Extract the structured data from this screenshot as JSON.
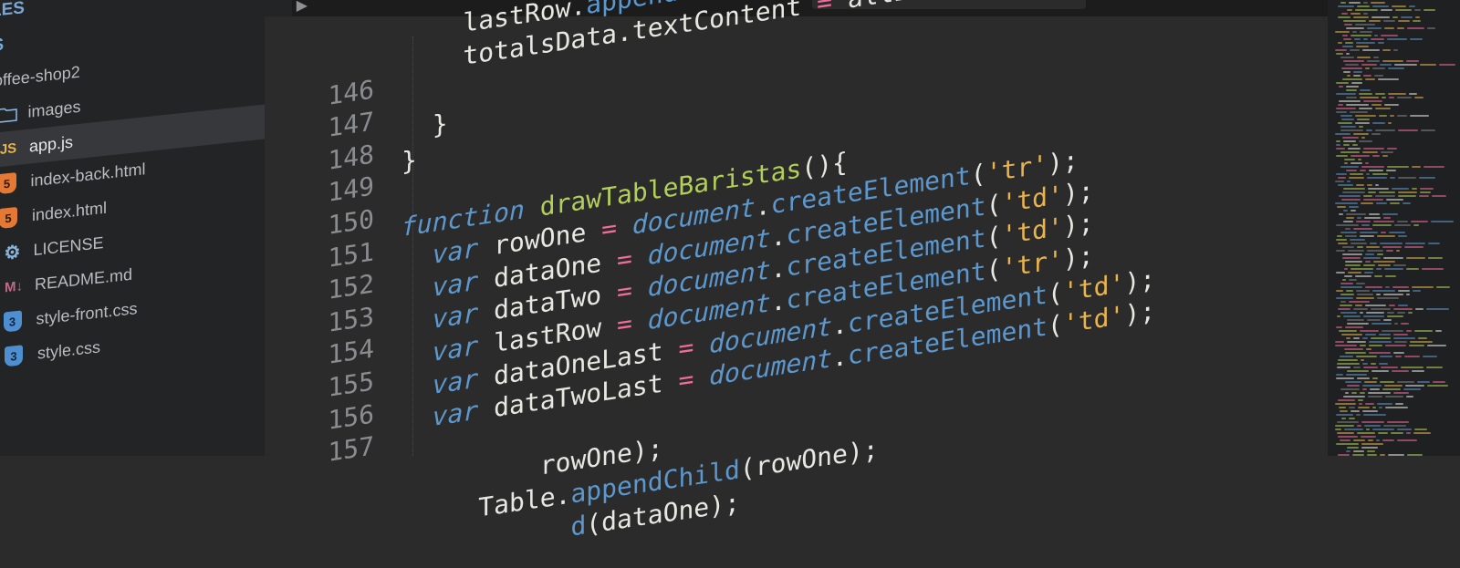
{
  "sidebar": {
    "items": [
      {
        "label": "LES",
        "kind": "header",
        "icon": "",
        "depth": 0
      },
      {
        "label": "S",
        "kind": "header",
        "icon": "",
        "depth": 0
      },
      {
        "label": "offee-shop2",
        "kind": "folder-open",
        "icon": "",
        "depth": 0
      },
      {
        "label": "images",
        "kind": "folder",
        "icon": "folder-icon",
        "depth": 1
      },
      {
        "label": "app.js",
        "kind": "file",
        "icon": "js-file-icon",
        "icon_text": "JS",
        "active": true,
        "depth": 1
      },
      {
        "label": "index-back.html",
        "kind": "file",
        "icon": "html5-file-icon",
        "icon_text": "5",
        "depth": 1
      },
      {
        "label": "index.html",
        "kind": "file",
        "icon": "html5-file-icon",
        "icon_text": "5",
        "depth": 1
      },
      {
        "label": "LICENSE",
        "kind": "file",
        "icon": "gear-icon",
        "icon_text": "⚙",
        "depth": 1
      },
      {
        "label": "README.md",
        "kind": "file",
        "icon": "markdown-icon",
        "icon_text": "M↓",
        "depth": 1
      },
      {
        "label": "style-front.css",
        "kind": "file",
        "icon": "css3-file-icon",
        "icon_text": "3",
        "depth": 1
      },
      {
        "label": "style.css",
        "kind": "file",
        "icon": "css3-file-icon",
        "icon_text": "3",
        "depth": 1
      }
    ]
  },
  "tabbar": {
    "nav_arrows": "◀ ▶"
  },
  "editor": {
    "line_numbers": [
      "",
      "146",
      "147",
      "148",
      "149",
      "150",
      "151",
      "152",
      "153",
      "154",
      "155",
      "156",
      "157"
    ],
    "lines": [
      {
        "tokens": [
          [
            "pl",
            "    lastRow."
          ],
          [
            "mt",
            "appendChild"
          ],
          [
            "pl",
            "(t"
          ]
        ]
      },
      {
        "tokens": [
          [
            "pl",
            "    totalsData.textContent "
          ],
          [
            "op",
            "="
          ],
          [
            "pl",
            " allBea"
          ]
        ]
      },
      {
        "tokens": [
          [
            "pl",
            ""
          ]
        ]
      },
      {
        "tokens": [
          [
            "pl",
            "  }"
          ]
        ]
      },
      {
        "tokens": [
          [
            "pl",
            "}"
          ]
        ]
      },
      {
        "tokens": [
          [
            "pl",
            ""
          ]
        ]
      },
      {
        "tokens": [
          [
            "kw",
            "function"
          ],
          [
            "pl",
            " "
          ],
          [
            "fn",
            "drawTableBaristas"
          ],
          [
            "pl",
            "(){"
          ]
        ]
      },
      {
        "tokens": [
          [
            "pl",
            "  "
          ],
          [
            "kw",
            "var"
          ],
          [
            "pl",
            " rowOne "
          ],
          [
            "op",
            "="
          ],
          [
            "pl",
            " "
          ],
          [
            "kw",
            "document"
          ],
          [
            "pl",
            "."
          ],
          [
            "mt",
            "createElement"
          ],
          [
            "pl",
            "("
          ],
          [
            "st",
            "'tr'"
          ],
          [
            "pl",
            ");"
          ]
        ]
      },
      {
        "tokens": [
          [
            "pl",
            "  "
          ],
          [
            "kw",
            "var"
          ],
          [
            "pl",
            " dataOne "
          ],
          [
            "op",
            "="
          ],
          [
            "pl",
            " "
          ],
          [
            "kw",
            "document"
          ],
          [
            "pl",
            "."
          ],
          [
            "mt",
            "createElement"
          ],
          [
            "pl",
            "("
          ],
          [
            "st",
            "'td'"
          ],
          [
            "pl",
            ");"
          ]
        ]
      },
      {
        "tokens": [
          [
            "pl",
            "  "
          ],
          [
            "kw",
            "var"
          ],
          [
            "pl",
            " dataTwo "
          ],
          [
            "op",
            "="
          ],
          [
            "pl",
            " "
          ],
          [
            "kw",
            "document"
          ],
          [
            "pl",
            "."
          ],
          [
            "mt",
            "createElement"
          ],
          [
            "pl",
            "("
          ],
          [
            "st",
            "'td'"
          ],
          [
            "pl",
            ");"
          ]
        ]
      },
      {
        "tokens": [
          [
            "pl",
            "  "
          ],
          [
            "kw",
            "var"
          ],
          [
            "pl",
            " lastRow "
          ],
          [
            "op",
            "="
          ],
          [
            "pl",
            " "
          ],
          [
            "kw",
            "document"
          ],
          [
            "pl",
            "."
          ],
          [
            "mt",
            "createElement"
          ],
          [
            "pl",
            "("
          ],
          [
            "st",
            "'tr'"
          ],
          [
            "pl",
            ");"
          ]
        ]
      },
      {
        "tokens": [
          [
            "pl",
            "  "
          ],
          [
            "kw",
            "var"
          ],
          [
            "pl",
            " dataOneLast "
          ],
          [
            "op",
            "="
          ],
          [
            "pl",
            " "
          ],
          [
            "kw",
            "document"
          ],
          [
            "pl",
            "."
          ],
          [
            "mt",
            "createElement"
          ],
          [
            "pl",
            "("
          ],
          [
            "st",
            "'td'"
          ],
          [
            "pl",
            ");"
          ]
        ]
      },
      {
        "tokens": [
          [
            "pl",
            "  "
          ],
          [
            "kw",
            "var"
          ],
          [
            "pl",
            " dataTwoLast "
          ],
          [
            "op",
            "="
          ],
          [
            "pl",
            " "
          ],
          [
            "kw",
            "document"
          ],
          [
            "pl",
            "."
          ],
          [
            "mt",
            "createElement"
          ],
          [
            "pl",
            "("
          ],
          [
            "st",
            "'td'"
          ],
          [
            "pl",
            ");"
          ]
        ]
      },
      {
        "tokens": [
          [
            "pl",
            ""
          ]
        ]
      },
      {
        "tokens": [
          [
            "pl",
            "  "
          ],
          [
            "pl",
            "    "
          ],
          [
            "pl",
            "   rowOne);"
          ]
        ]
      },
      {
        "tokens": [
          [
            "pl",
            "  "
          ],
          [
            "pl",
            "   Table."
          ],
          [
            "mt",
            "appendChild"
          ],
          [
            "pl",
            "(rowOne);"
          ]
        ]
      },
      {
        "tokens": [
          [
            "pl",
            "           "
          ],
          [
            "mt",
            "d"
          ],
          [
            "pl",
            "(dataOne);"
          ]
        ]
      }
    ]
  },
  "colors": {
    "background": "#2b2b2c",
    "sidebar": "#232425",
    "keyword": "#5c98cd",
    "function_name": "#b3cf5b",
    "string": "#e9b44c",
    "operator": "#f06c9b"
  }
}
